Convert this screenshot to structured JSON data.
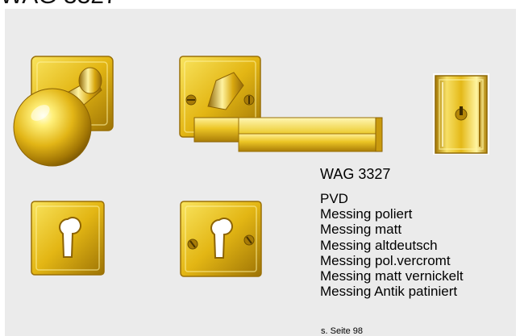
{
  "header": {
    "title": "WAG 3327"
  },
  "product": {
    "model": "WAG 3327",
    "variants": [
      "PVD",
      "Messing poliert",
      "Messing matt",
      "Messing altdeutsch",
      "Messing pol.vercromt",
      "Messing matt vernickelt",
      "Messing Antik patiniert"
    ],
    "reference": "s. Seite 98"
  },
  "colors": {
    "panel_background": "#ebebeb",
    "brass_light": "#fff27a",
    "brass_mid": "#e8c21a",
    "brass_dark": "#9c7204"
  },
  "images": [
    "knob-on-square-rose",
    "lever-handle-on-square-rose",
    "narrow-backplate-with-key-turn",
    "square-escutcheon-profile-cylinder",
    "square-escutcheon-profile-cylinder-with-screws"
  ]
}
